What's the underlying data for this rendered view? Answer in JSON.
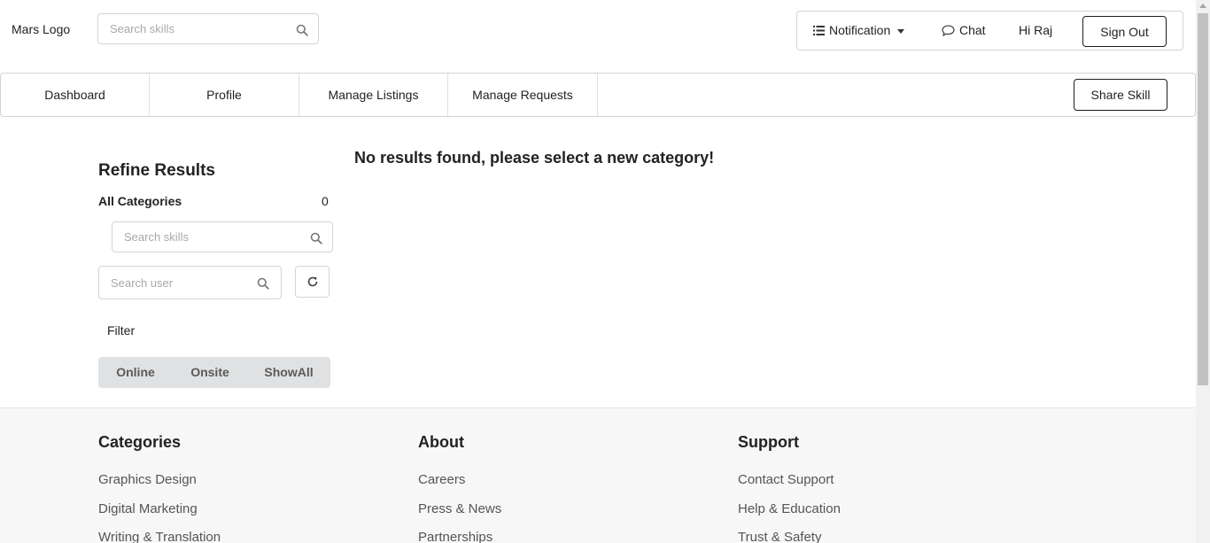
{
  "header": {
    "logo": "Mars Logo",
    "search_placeholder": "Search skills",
    "notification_label": "Notification",
    "chat_label": "Chat",
    "greeting": "Hi Raj",
    "signout_label": "Sign Out"
  },
  "nav": {
    "tabs": [
      {
        "label": "Dashboard"
      },
      {
        "label": "Profile"
      },
      {
        "label": "Manage Listings"
      },
      {
        "label": "Manage Requests"
      }
    ],
    "share_label": "Share Skill"
  },
  "sidebar": {
    "title": "Refine Results",
    "all_categories_label": "All Categories",
    "all_categories_count": "0",
    "skill_search_placeholder": "Search skills",
    "user_search_placeholder": "Search user",
    "filter_label": "Filter",
    "filter_options": [
      "Online",
      "Onsite",
      "ShowAll"
    ]
  },
  "main": {
    "message": "No results found, please select a new category!"
  },
  "footer": {
    "columns": [
      {
        "heading": "Categories",
        "links": [
          "Graphics Design",
          "Digital Marketing",
          "Writing & Translation"
        ]
      },
      {
        "heading": "About",
        "links": [
          "Careers",
          "Press & News",
          "Partnerships"
        ]
      },
      {
        "heading": "Support",
        "links": [
          "Contact Support",
          "Help & Education",
          "Trust & Safety"
        ]
      }
    ]
  },
  "icons": {
    "search": "search-icon",
    "list": "list-icon",
    "chat": "chat-bubble-icon",
    "refresh": "refresh-icon",
    "caret": "chevron-down-icon"
  }
}
